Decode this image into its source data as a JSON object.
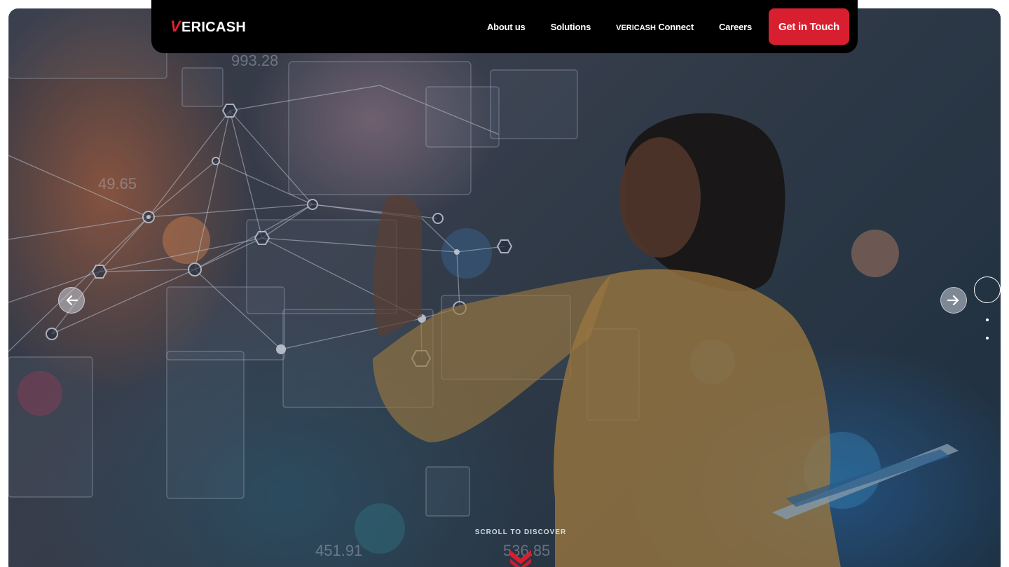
{
  "brand": {
    "logo_mark": "V",
    "logo_text": "ERICASH",
    "accent_color": "#d71f2f"
  },
  "nav": {
    "items": [
      {
        "label": "About us"
      },
      {
        "label": "Solutions"
      },
      {
        "label_caps": "VERICASH",
        "label": " Connect"
      },
      {
        "label": "Careers"
      }
    ],
    "cta_label": "Get in Touch"
  },
  "hero": {
    "prev_icon": "arrow-left-icon",
    "next_icon": "arrow-right-icon",
    "slides_count": 3,
    "active_slide": 1,
    "scroll_label": "SCROLL TO DISCOVER",
    "scroll_icon": "chevron-double-down-icon"
  }
}
